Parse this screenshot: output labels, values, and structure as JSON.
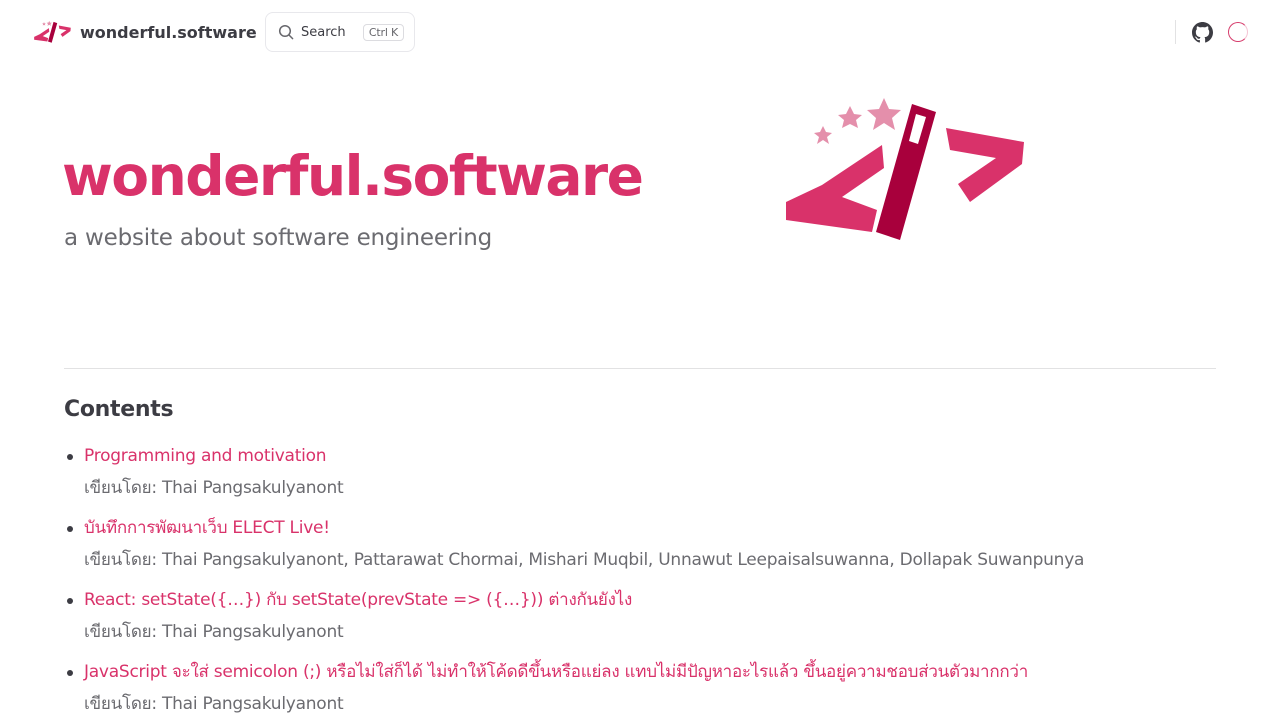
{
  "nav": {
    "site_title": "wonderful.software",
    "search": {
      "label": "Search",
      "shortcut": "Ctrl K"
    }
  },
  "hero": {
    "name": "wonderful.software",
    "tagline": "a website about software engineering"
  },
  "contents": {
    "heading": "Contents",
    "posts": [
      {
        "title": "Programming and motivation",
        "byline": "เขียนโดย: Thai Pangsakulyanont"
      },
      {
        "title": "บันทึกการพัฒนาเว็บ ELECT Live!",
        "byline": "เขียนโดย: Thai Pangsakulyanont, Pattarawat Chormai, Mishari Muqbil, Unnawut Leepaisalsuwanna, Dollapak Suwanpunya"
      },
      {
        "title": "React: setState({…}) กับ setState(prevState => ({…})) ต่างกันยังไง",
        "byline": "เขียนโดย: Thai Pangsakulyanont"
      },
      {
        "title": "JavaScript จะใส่ semicolon (;) หรือไม่ใส่ก็ได้ ไม่ทำให้โค้ดดีขึ้นหรือแย่ลง แทบไม่มีปัญหาอะไรแล้ว ขึ้นอยู่ความชอบส่วนตัวมากกว่า",
        "byline": "เขียนโดย: Thai Pangsakulyanont"
      }
    ]
  },
  "colors": {
    "brand": "#d9326a",
    "brand_dark": "#a8003c",
    "brand_light": "#e48fab",
    "text": "#3c3c43",
    "muted": "#6b6b70"
  },
  "icons": {
    "logo": "code-wand-logo-icon",
    "search": "search-icon",
    "github": "github-icon",
    "loader": "loading-spinner-icon"
  }
}
